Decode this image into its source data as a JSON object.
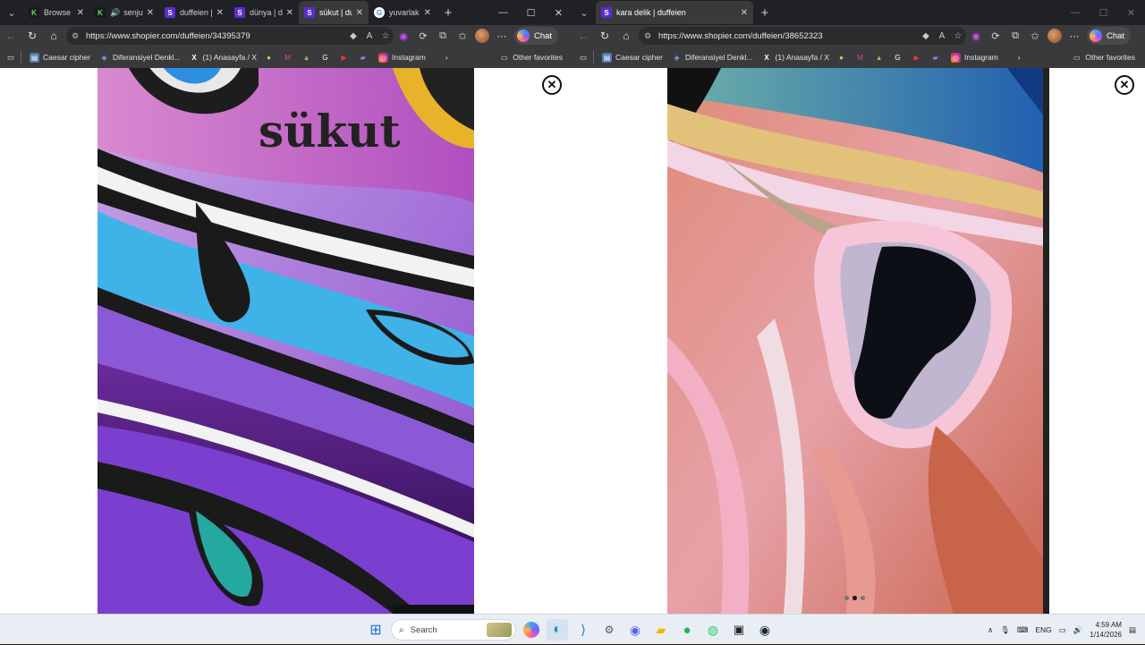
{
  "left_window": {
    "tabs": [
      {
        "title": "Browse - K",
        "favicon": "K",
        "kind": "k",
        "active": false
      },
      {
        "title": "senjut",
        "favicon": "K",
        "kind": "k",
        "active": false,
        "audio": true
      },
      {
        "title": "duffeien | S",
        "favicon": "S",
        "kind": "s",
        "active": false
      },
      {
        "title": "dünya | duf",
        "favicon": "S",
        "kind": "s",
        "active": false
      },
      {
        "title": "sükut | duf",
        "favicon": "S",
        "kind": "s",
        "active": true
      },
      {
        "title": "yuvarlak d",
        "favicon": "G",
        "kind": "g",
        "active": false
      }
    ],
    "url": "https://www.shopier.com/duffeien/34395379",
    "copilot_label": "Chat",
    "artwork_signature_text": "sükut"
  },
  "right_window": {
    "tabs": [
      {
        "title": "kara delik | duffeien",
        "favicon": "S",
        "kind": "s",
        "active": true
      }
    ],
    "url": "https://www.shopier.com/duffeien/38652323",
    "copilot_label": "Chat"
  },
  "bookmarks": {
    "items": [
      "Caesar cipher",
      "Diferansiyel Denkl...",
      "(1) Anasayfa / X",
      "Instagram"
    ],
    "other": "Other favorites"
  },
  "taskbar": {
    "search_placeholder": "Search",
    "language": "ENG",
    "time": "4:59 AM",
    "date": "1/14/2026"
  },
  "colors": {
    "tab_strip": "#202124",
    "toolbar": "#3a3a3d",
    "shopier_purple": "#5b2bd3",
    "taskbar": "#e9eef5"
  }
}
